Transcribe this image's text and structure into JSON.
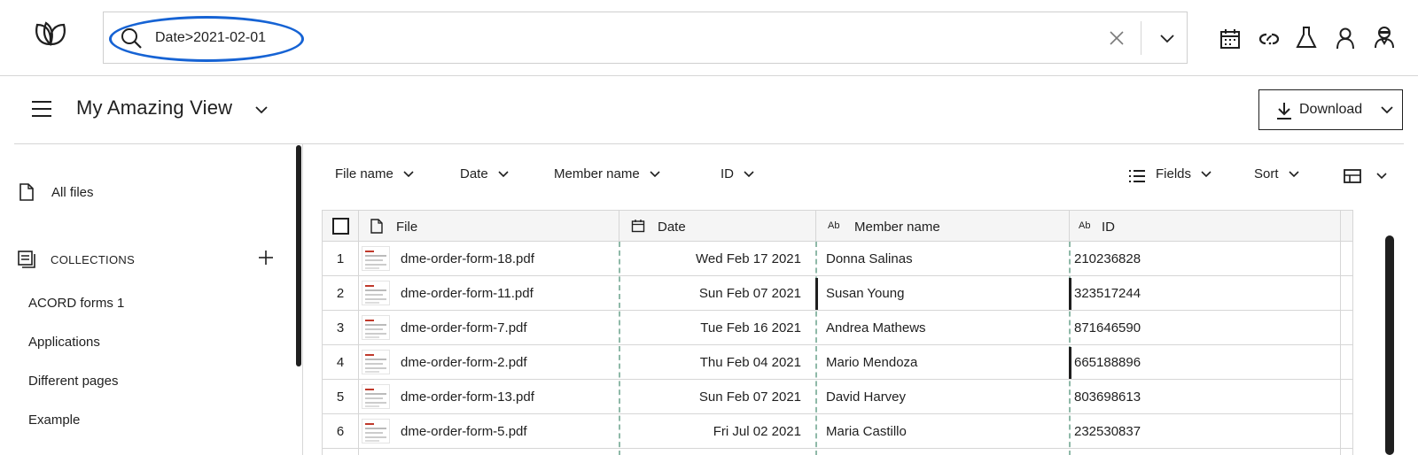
{
  "search": {
    "value": "Date>2021-02-01"
  },
  "view": {
    "title": "My Amazing View"
  },
  "toolbar": {
    "download_label": "Download"
  },
  "sidebar": {
    "all_files": "All files",
    "collections_label": "COLLECTIONS",
    "collections": [
      "ACORD forms 1",
      "Applications",
      "Different pages",
      "Example"
    ]
  },
  "filters": {
    "file_name": "File name",
    "date": "Date",
    "member_name": "Member name",
    "id": "ID",
    "fields": "Fields",
    "sort": "Sort"
  },
  "table": {
    "columns": {
      "file": "File",
      "date": "Date",
      "member": "Member name",
      "id": "ID"
    },
    "type_badges": {
      "member": "Ab",
      "id": "Ab"
    },
    "rows": [
      {
        "num": "1",
        "file": "dme-order-form-18.pdf",
        "date": "Wed Feb 17 2021",
        "member": "Donna Salinas",
        "id": "210236828"
      },
      {
        "num": "2",
        "file": "dme-order-form-11.pdf",
        "date": "Sun Feb 07 2021",
        "member": "Susan Young",
        "id": "323517244"
      },
      {
        "num": "3",
        "file": "dme-order-form-7.pdf",
        "date": "Tue Feb 16 2021",
        "member": "Andrea Mathews",
        "id": "871646590"
      },
      {
        "num": "4",
        "file": "dme-order-form-2.pdf",
        "date": "Thu Feb 04 2021",
        "member": "Mario Mendoza",
        "id": "665188896"
      },
      {
        "num": "5",
        "file": "dme-order-form-13.pdf",
        "date": "Sun Feb 07 2021",
        "member": "David Harvey",
        "id": "803698613"
      },
      {
        "num": "6",
        "file": "dme-order-form-5.pdf",
        "date": "Fri Jul 02 2021",
        "member": "Maria Castillo",
        "id": "232530837"
      }
    ]
  },
  "icons": {
    "logo": "logo-leaf-icon",
    "search": "search-icon",
    "clear": "close-icon",
    "expand": "chevron-down-icon",
    "top": [
      "calendar-icon",
      "link-icon",
      "flask-icon",
      "user-icon",
      "agent-icon"
    ]
  },
  "colors": {
    "highlight": "#1663d4",
    "dashed_column": "#8fb9a8",
    "thumb_accent": "#c0392b"
  }
}
